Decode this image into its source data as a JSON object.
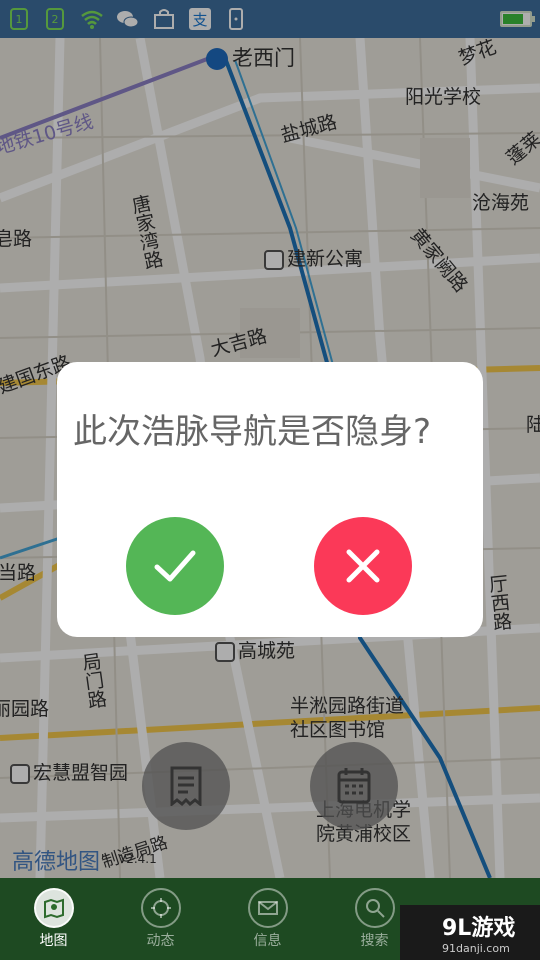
{
  "status_bar": {
    "icons": [
      "sim1-icon",
      "sim2-icon",
      "wifi-icon",
      "wechat-icon",
      "bag-icon",
      "alipay-icon",
      "phone-icon"
    ],
    "battery_level": 0.7
  },
  "map": {
    "labels": {
      "metro_station": "老西门",
      "metro_line": "地铁10号线",
      "school_1": "阳光学校",
      "road_1": "盐城路",
      "road_2": "唐家湾路",
      "road_3": "建国东路",
      "road_4": "大吉路",
      "poi_1": "建新公寓",
      "road_5": "黄家阙路",
      "poi_2": "沧海苑",
      "road_6": "蓬莱",
      "road_7": "梦花",
      "road_8": "当路",
      "road_9": "局门路",
      "road_10": "丽园路",
      "poi_3": "高城苑",
      "library": "半淞园路街道\n社区图书馆",
      "poi_4": "宏慧盟智园",
      "school_2": "上海电机学\n院黄浦校区",
      "road_11": "厅西路",
      "road_12": "制造局路",
      "road_13": "皂路",
      "road_14": "陆",
      "map_brand": "高德地图",
      "map_version": "V2.4.1"
    }
  },
  "dialog": {
    "title": "此次浩脉导航是否隐身?",
    "confirm_icon": "check-icon",
    "cancel_icon": "close-icon",
    "confirm_color": "#54b656",
    "cancel_color": "#fb3958"
  },
  "fabs": {
    "left_icon": "document-icon",
    "right_icon": "calendar-icon"
  },
  "bottom_nav": {
    "items": [
      {
        "label": "地图",
        "icon": "map-pin-icon",
        "active": true
      },
      {
        "label": "动态",
        "icon": "target-icon",
        "active": false
      },
      {
        "label": "信息",
        "icon": "mail-icon",
        "active": false
      },
      {
        "label": "搜索",
        "icon": "search-icon",
        "active": false
      }
    ]
  },
  "watermark": {
    "main": "9L游戏",
    "sub": "91danji.com"
  }
}
